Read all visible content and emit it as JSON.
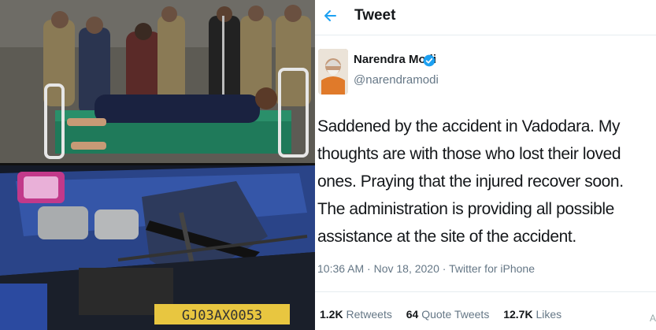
{
  "header": {
    "title": "Tweet"
  },
  "user": {
    "name": "Narendra Modi",
    "handle": "@narendramodi"
  },
  "tweet": {
    "text": "Saddened by the accident in Vadodara. My thoughts are with those who lost their loved ones. Praying that the injured recover soon. The administration is providing all possible assistance at the site of the accident.",
    "time": "10:36 AM",
    "date": "Nov 18, 2020",
    "source": "Twitter for iPhone",
    "meta": "10:36 AM · Nov 18, 2020 · Twitter for iPhone"
  },
  "stats": {
    "retweets_count": "1.2K",
    "retweets_label": "Retweets",
    "quote_count": "64",
    "quote_label": "Quote Tweets",
    "likes_count": "12.7K",
    "likes_label": "Likes"
  },
  "corner": "A",
  "license_plate": "GJ03AX0053",
  "colors": {
    "accent": "#1da1f2",
    "text_primary": "#14171a",
    "text_secondary": "#657786",
    "divider": "#e6ecf0"
  },
  "icons": {
    "back": "arrow-left-icon",
    "verified": "verified-badge-icon"
  }
}
